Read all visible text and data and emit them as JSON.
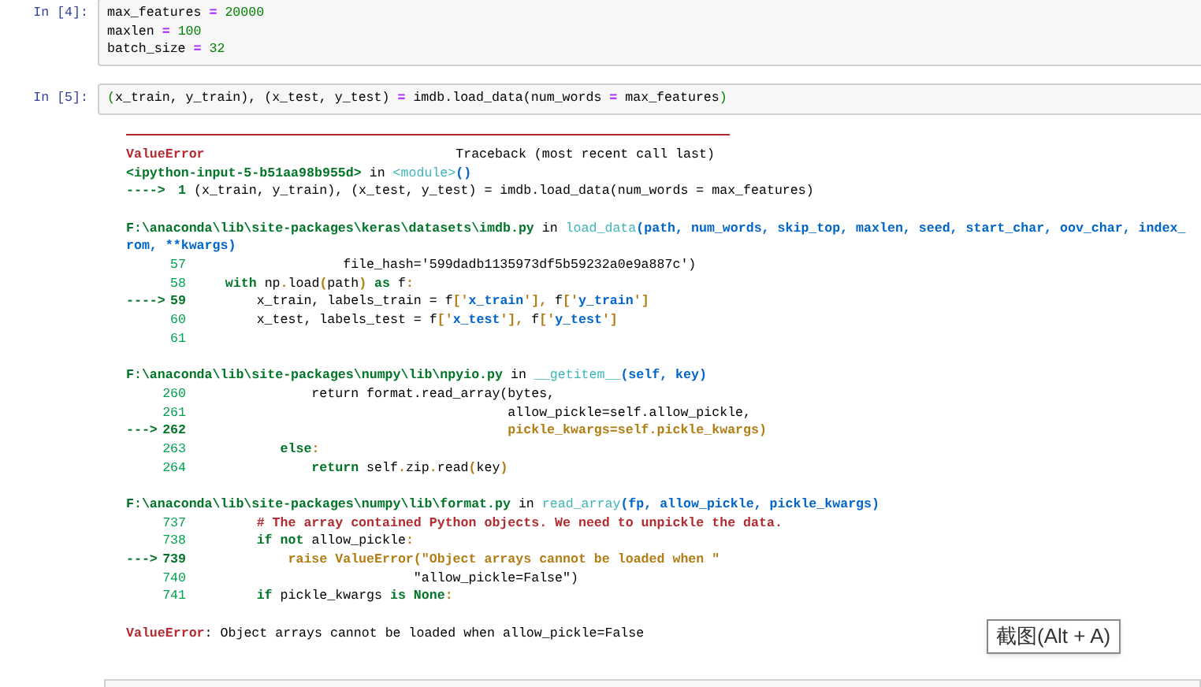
{
  "cells": [
    {
      "prompt": "In [4]:",
      "code": [
        [
          {
            "kind": "plain",
            "text": "max_features "
          },
          {
            "kind": "operator",
            "text": "="
          },
          {
            "kind": "number",
            "text": " 20000"
          }
        ],
        [
          {
            "kind": "plain",
            "text": "maxlen "
          },
          {
            "kind": "operator",
            "text": "="
          },
          {
            "kind": "number",
            "text": " 100"
          }
        ],
        [
          {
            "kind": "plain",
            "text": "batch_size "
          },
          {
            "kind": "operator",
            "text": "="
          },
          {
            "kind": "number",
            "text": " 32"
          }
        ]
      ]
    },
    {
      "prompt": "In [5]:",
      "code": [
        [
          {
            "kind": "bracket",
            "text": "("
          },
          {
            "kind": "plain",
            "text": "x_train, y_train), (x_test, y_test) "
          },
          {
            "kind": "operator",
            "text": "="
          },
          {
            "kind": "plain",
            "text": " imdb.load_data(num_words "
          },
          {
            "kind": "operator",
            "text": "="
          },
          {
            "kind": "plain",
            "text": " max_features"
          },
          {
            "kind": "bracket",
            "text": ")"
          }
        ]
      ],
      "traceback": {
        "title": [
          {
            "kind": "error",
            "text": "ValueError"
          },
          {
            "kind": "plain",
            "text": "                                Traceback (most recent call last)"
          }
        ],
        "frames": [
          {
            "header": [
              [
                {
                  "kind": "path",
                  "text": "<ipython-input-5-b51aa98b955d>"
                },
                {
                  "kind": "plain",
                  "text": " in "
                },
                {
                  "kind": "func",
                  "text": "<module>"
                },
                {
                  "kind": "args",
                  "text": "()"
                }
              ]
            ],
            "lines": [
              {
                "arrow": "---->",
                "number": "1",
                "current": true,
                "tokens": [
                  {
                    "kind": "plain",
                    "text": "(x_train, y_train), (x_test, y_test) = imdb.load_data(num_words = max_features)"
                  }
                ]
              }
            ]
          },
          {
            "header": [
              [
                {
                  "kind": "path",
                  "text": "F:\\anaconda\\lib\\site-packages\\keras\\datasets\\imdb.py"
                },
                {
                  "kind": "plain",
                  "text": " in "
                },
                {
                  "kind": "func",
                  "text": "load_data"
                },
                {
                  "kind": "args",
                  "text": "(path, num_words, skip_top, maxlen, seed, start_char, oov_char, index_"
                }
              ],
              [
                {
                  "kind": "args",
                  "text": "rom, **kwargs)"
                }
              ]
            ],
            "lines": [
              {
                "number": "57",
                "current": false,
                "tokens": [
                  {
                    "kind": "plain",
                    "text": "                   file_hash='599dadb1135973df5b59232a0e9a887c')"
                  }
                ]
              },
              {
                "number": "58",
                "current": false,
                "tokens": [
                  {
                    "kind": "keyword",
                    "text": "    with"
                  },
                  {
                    "kind": "plain",
                    "text": " np"
                  },
                  {
                    "kind": "punct",
                    "text": "."
                  },
                  {
                    "kind": "plain",
                    "text": "load"
                  },
                  {
                    "kind": "punct",
                    "text": "("
                  },
                  {
                    "kind": "plain",
                    "text": "path"
                  },
                  {
                    "kind": "punct",
                    "text": ")"
                  },
                  {
                    "kind": "keyword",
                    "text": " as"
                  },
                  {
                    "kind": "plain",
                    "text": " f"
                  },
                  {
                    "kind": "punct",
                    "text": ":"
                  }
                ]
              },
              {
                "arrow": "---->",
                "number": "59",
                "current": true,
                "tokens": [
                  {
                    "kind": "plain",
                    "text": "        x_train, labels_train = f"
                  },
                  {
                    "kind": "punct",
                    "text": "['"
                  },
                  {
                    "kind": "string",
                    "text": "x_train"
                  },
                  {
                    "kind": "punct",
                    "text": "'],"
                  },
                  {
                    "kind": "plain",
                    "text": " f"
                  },
                  {
                    "kind": "punct",
                    "text": "['"
                  },
                  {
                    "kind": "string",
                    "text": "y_train"
                  },
                  {
                    "kind": "punct",
                    "text": "']"
                  }
                ]
              },
              {
                "number": "60",
                "current": false,
                "tokens": [
                  {
                    "kind": "plain",
                    "text": "        x_test, labels_test = f"
                  },
                  {
                    "kind": "punct",
                    "text": "['"
                  },
                  {
                    "kind": "string",
                    "text": "x_test"
                  },
                  {
                    "kind": "punct",
                    "text": "'],"
                  },
                  {
                    "kind": "plain",
                    "text": " f"
                  },
                  {
                    "kind": "punct",
                    "text": "['"
                  },
                  {
                    "kind": "string",
                    "text": "y_test"
                  },
                  {
                    "kind": "punct",
                    "text": "']"
                  }
                ]
              },
              {
                "number": "61",
                "current": false
              }
            ]
          },
          {
            "header": [
              [
                {
                  "kind": "path",
                  "text": "F:\\anaconda\\lib\\site-packages\\numpy\\lib\\npyio.py"
                },
                {
                  "kind": "plain",
                  "text": " in "
                },
                {
                  "kind": "func",
                  "text": "__getitem__"
                },
                {
                  "kind": "args",
                  "text": "(self, key)"
                }
              ]
            ],
            "lines": [
              {
                "number": "260",
                "current": false,
                "tokens": [
                  {
                    "kind": "plain",
                    "text": "               return format.read_array(bytes,"
                  }
                ]
              },
              {
                "number": "261",
                "current": false,
                "tokens": [
                  {
                    "kind": "plain",
                    "text": "                                        allow_pickle=self.allow_pickle,"
                  }
                ]
              },
              {
                "arrow": "--->",
                "number": "262",
                "current": true,
                "tokens": [
                  {
                    "kind": "active",
                    "text": "                                        pickle_kwargs=self.pickle_kwargs)"
                  }
                ]
              },
              {
                "number": "263",
                "current": false,
                "tokens": [
                  {
                    "kind": "keyword",
                    "text": "           else"
                  },
                  {
                    "kind": "punct",
                    "text": ":"
                  }
                ]
              },
              {
                "number": "264",
                "current": false,
                "tokens": [
                  {
                    "kind": "keyword",
                    "text": "               return"
                  },
                  {
                    "kind": "plain",
                    "text": " self"
                  },
                  {
                    "kind": "punct",
                    "text": "."
                  },
                  {
                    "kind": "plain",
                    "text": "zip"
                  },
                  {
                    "kind": "punct",
                    "text": "."
                  },
                  {
                    "kind": "plain",
                    "text": "read"
                  },
                  {
                    "kind": "punct",
                    "text": "("
                  },
                  {
                    "kind": "plain",
                    "text": "key"
                  },
                  {
                    "kind": "punct",
                    "text": ")"
                  }
                ]
              }
            ]
          },
          {
            "header": [
              [
                {
                  "kind": "path",
                  "text": "F:\\anaconda\\lib\\site-packages\\numpy\\lib\\format.py"
                },
                {
                  "kind": "plain",
                  "text": " in "
                },
                {
                  "kind": "func",
                  "text": "read_array"
                },
                {
                  "kind": "args",
                  "text": "(fp, allow_pickle, pickle_kwargs)"
                }
              ]
            ],
            "lines": [
              {
                "number": "737",
                "current": false,
                "tokens": [
                  {
                    "kind": "comment",
                    "text": "        # The array contained Python objects. We need to unpickle the data."
                  }
                ]
              },
              {
                "number": "738",
                "current": false,
                "tokens": [
                  {
                    "kind": "keyword",
                    "text": "        if not"
                  },
                  {
                    "kind": "plain",
                    "text": " allow_pickle"
                  },
                  {
                    "kind": "punct",
                    "text": ":"
                  }
                ]
              },
              {
                "arrow": "--->",
                "number": "739",
                "current": true,
                "tokens": [
                  {
                    "kind": "active",
                    "text": "            raise ValueError(\"Object arrays cannot be loaded when \""
                  }
                ]
              },
              {
                "number": "740",
                "current": false,
                "tokens": [
                  {
                    "kind": "plain",
                    "text": "                            \"allow_pickle=False\")"
                  }
                ]
              },
              {
                "number": "741",
                "current": false,
                "tokens": [
                  {
                    "kind": "keyword",
                    "text": "        if"
                  },
                  {
                    "kind": "plain",
                    "text": " pickle_kwargs "
                  },
                  {
                    "kind": "keyword",
                    "text": "is None"
                  },
                  {
                    "kind": "punct",
                    "text": ":"
                  }
                ]
              }
            ]
          }
        ],
        "message": [
          {
            "kind": "error",
            "text": "ValueError"
          },
          {
            "kind": "plain",
            "text": ": Object arrays cannot be loaded when allow_pickle=False"
          }
        ]
      }
    }
  ],
  "tooltip": {
    "text": "截图(Alt + A)"
  }
}
